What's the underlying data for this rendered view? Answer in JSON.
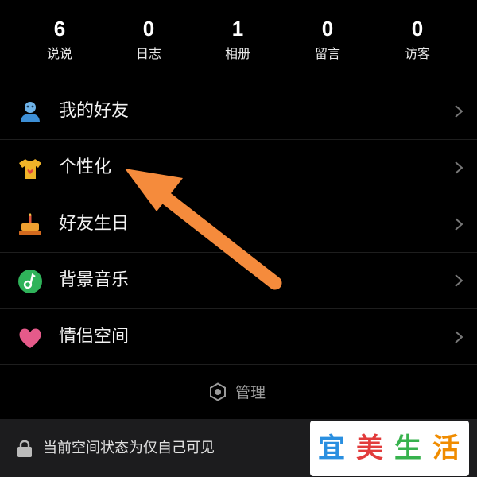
{
  "stats": [
    {
      "value": "6",
      "label": "说说"
    },
    {
      "value": "0",
      "label": "日志"
    },
    {
      "value": "1",
      "label": "相册"
    },
    {
      "value": "0",
      "label": "留言"
    },
    {
      "value": "0",
      "label": "访客"
    }
  ],
  "menu": [
    {
      "label": "我的好友",
      "icon": "friends-icon"
    },
    {
      "label": "个性化",
      "icon": "tshirt-icon"
    },
    {
      "label": "好友生日",
      "icon": "cake-icon"
    },
    {
      "label": "背景音乐",
      "icon": "music-icon"
    },
    {
      "label": "情侣空间",
      "icon": "heart-icon"
    }
  ],
  "manage": {
    "label": "管理",
    "icon": "hexagon-settings-icon"
  },
  "status": {
    "text": "当前空间状态为仅自己可见",
    "icon": "lock-icon"
  },
  "watermark": {
    "chars": [
      "宜",
      "美",
      "生",
      "活"
    ],
    "colors": [
      "#2a8fe0",
      "#e23b3b",
      "#37b24d",
      "#f08c00"
    ]
  },
  "colors": {
    "background": "#000000",
    "arrow": "#f58b3c",
    "chevron": "#777777"
  }
}
